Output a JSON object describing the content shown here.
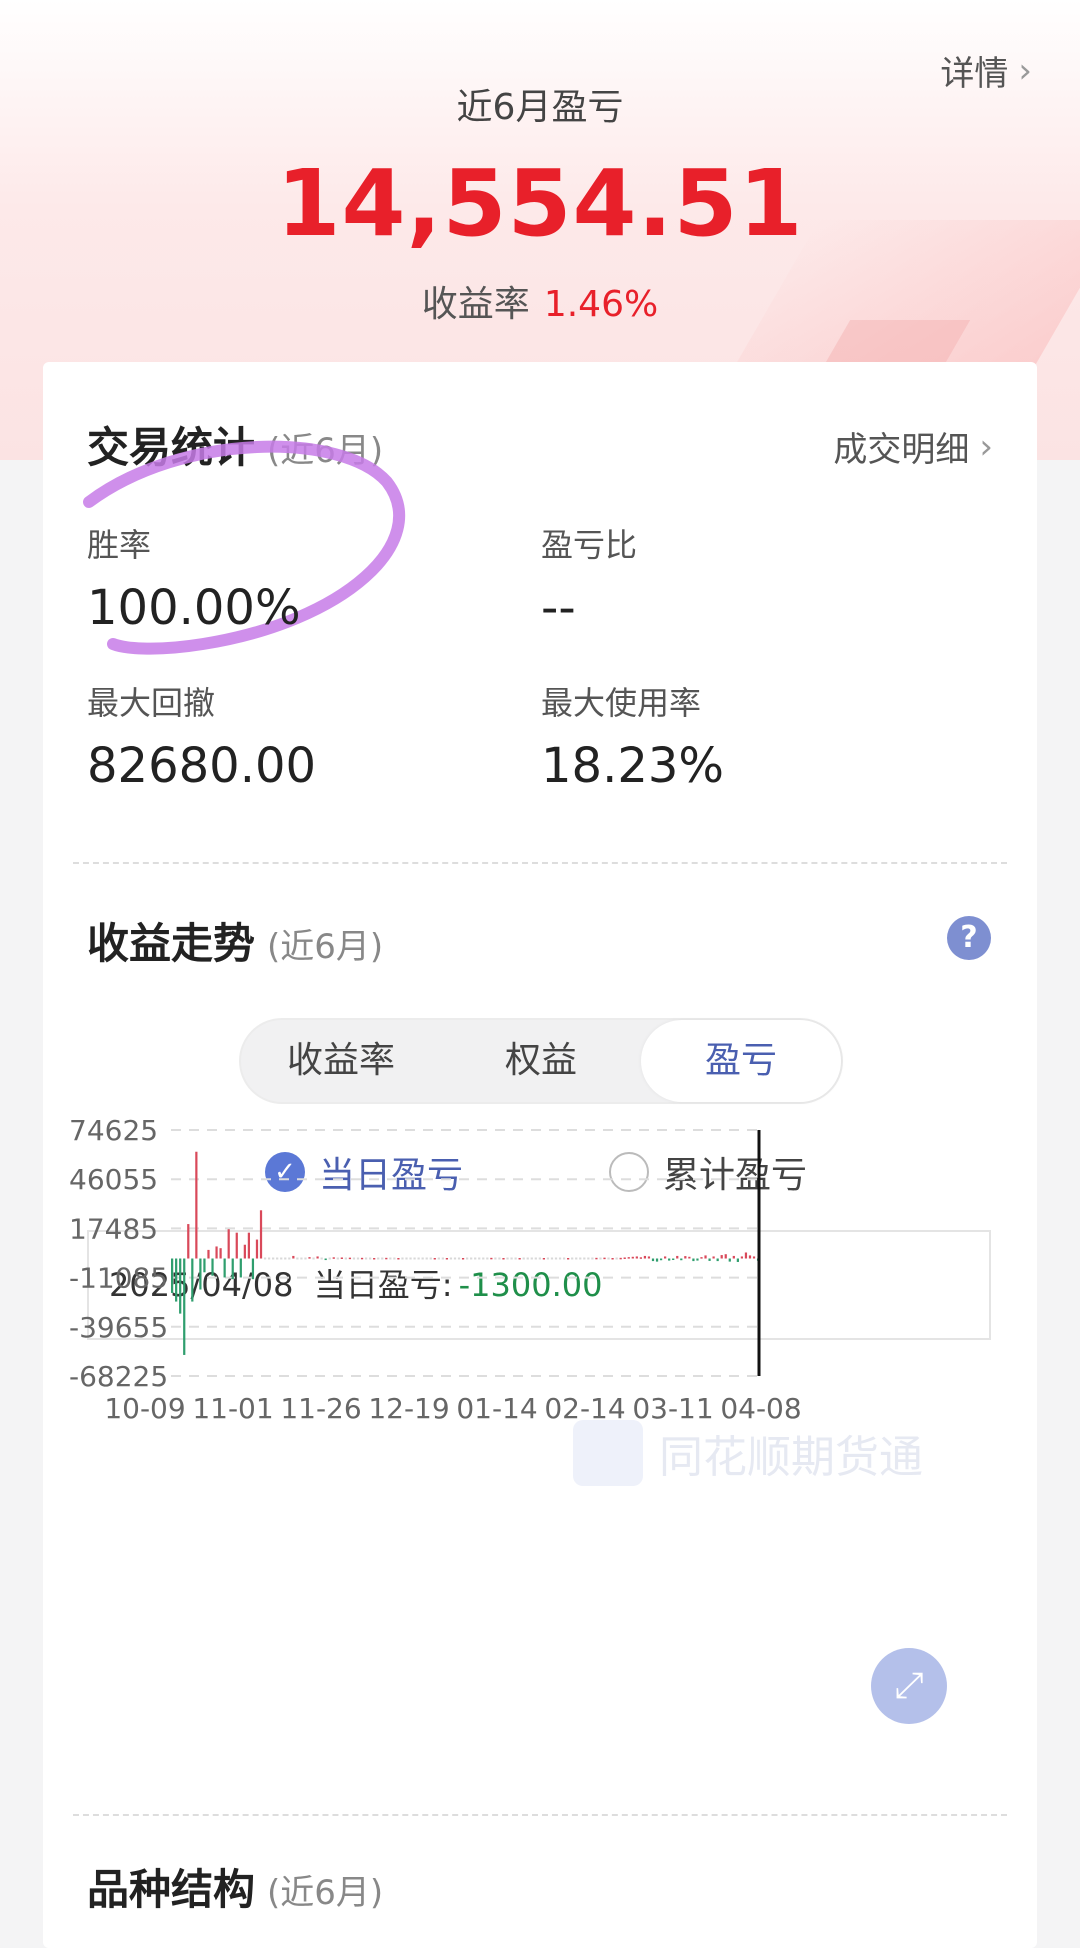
{
  "header": {
    "detail_label": "详情",
    "title": "近6月盈亏",
    "amount": "14,554.51",
    "rate_label": "收益率",
    "rate_value": "1.46%"
  },
  "trade_stats": {
    "title": "交易统计",
    "period": "(近6月)",
    "detail_link": "成交明细",
    "items": [
      {
        "label": "胜率",
        "value": "100.00%"
      },
      {
        "label": "盈亏比",
        "value": "--"
      },
      {
        "label": "最大回撤",
        "value": "82680.00"
      },
      {
        "label": "最大使用率",
        "value": "18.23%"
      }
    ]
  },
  "trend": {
    "title": "收益走势",
    "period": "(近6月)",
    "help": "?",
    "tabs": [
      "收益率",
      "权益",
      "盈亏"
    ],
    "active_tab": 2,
    "radios": [
      {
        "label": "当日盈亏",
        "checked": true
      },
      {
        "label": "累计盈亏",
        "checked": false
      }
    ],
    "tooltip": {
      "date": "2025/04/08",
      "label": "当日盈亏:",
      "value": "-1300.00"
    },
    "watermark": "同花顺期货通"
  },
  "chart_data": {
    "type": "bar",
    "y_ticks": [
      "74625",
      "46055",
      "17485",
      "-11085",
      "-39655",
      "-68225"
    ],
    "x_ticks": [
      "10-09",
      "11-01",
      "11-26",
      "12-19",
      "01-14",
      "02-14",
      "03-11",
      "04-08"
    ],
    "ylim": [
      -68225,
      74625
    ],
    "values": [
      -20000,
      -25000,
      -32000,
      -56000,
      20000,
      -25000,
      62000,
      -18000,
      -8000,
      5000,
      -10000,
      7000,
      6000,
      -11000,
      17000,
      -12000,
      15000,
      -11000,
      8000,
      15000,
      -12000,
      11000,
      28000,
      0,
      0,
      0,
      0,
      0,
      0,
      0,
      1500,
      0,
      0,
      0,
      800,
      0,
      1200,
      0,
      -900,
      0,
      700,
      0,
      600,
      0,
      500,
      0,
      0,
      400,
      0,
      0,
      300,
      0,
      0,
      400,
      0,
      0,
      300,
      0,
      0,
      0,
      0,
      0,
      0,
      0,
      0,
      300,
      0,
      0,
      300,
      0,
      0,
      0,
      300,
      0,
      0,
      0,
      0,
      0,
      0,
      400,
      0,
      0,
      300,
      0,
      0,
      0,
      300,
      0,
      0,
      0,
      0,
      0,
      300,
      0,
      0,
      0,
      0,
      0,
      300,
      0,
      0,
      0,
      0,
      0,
      0,
      400,
      0,
      500,
      0,
      300,
      0,
      400,
      600,
      800,
      1000,
      1200,
      700,
      1500,
      1200,
      -1500,
      -1800,
      -1000,
      1200,
      -1200,
      -800,
      1500,
      -1000,
      1400,
      1000,
      -1500,
      -1200,
      800,
      1800,
      -1400,
      1200,
      -1500,
      2000,
      2500,
      -1800,
      1500,
      -2000,
      1200,
      3500,
      1800,
      1200,
      -1300
    ],
    "colors": {
      "positive": "#d9495a",
      "negative": "#2f9e6e",
      "cursor": "#111111"
    }
  },
  "structure": {
    "title": "品种结构",
    "period": "(近6月)"
  }
}
